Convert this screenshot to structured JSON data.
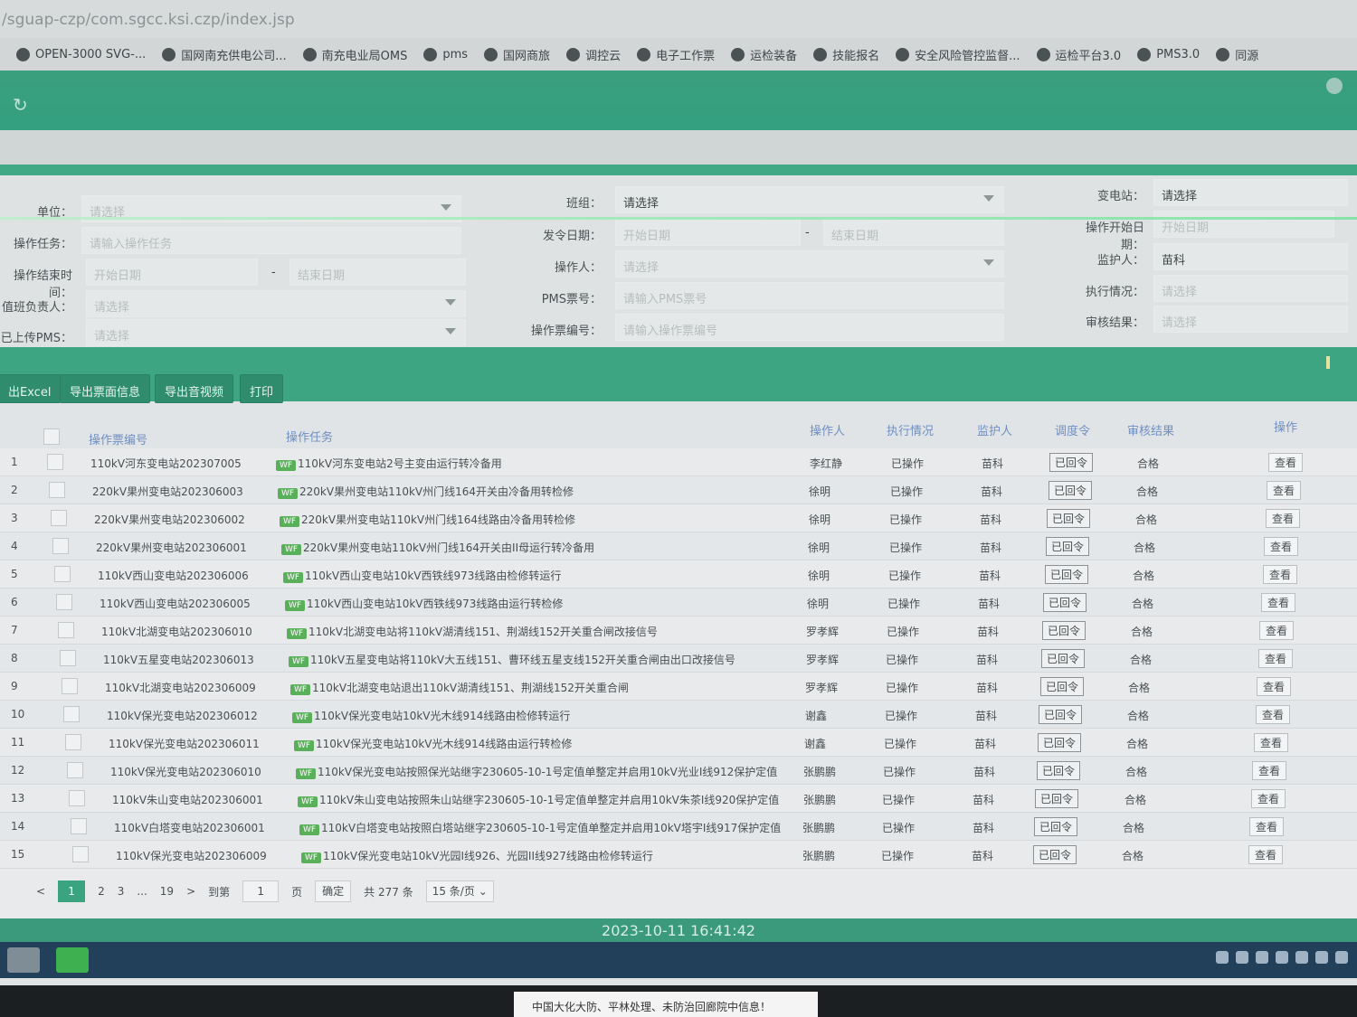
{
  "url": "/sguap-czp/com.sgcc.ksi.czp/index.jsp",
  "bookmarks": [
    "OPEN-3000 SVG-...",
    "国网南充供电公司...",
    "南充电业局OMS",
    "pms",
    "国网商旅",
    "调控云",
    "电子工作票",
    "运检装备",
    "技能报名",
    "安全风险管控监督...",
    "运检平台3.0",
    "PMS3.0",
    "同源"
  ],
  "filters": {
    "unit_label": "单位：",
    "unit_placeholder": "请选择",
    "task_label": "操作任务：",
    "task_placeholder": "请输入操作任务",
    "end_time_label": "操作结束时间：",
    "start_date_placeholder": "开始日期",
    "end_date_placeholder": "结束日期",
    "duty_label": "值班负责人：",
    "duty_placeholder": "请选择",
    "pms_uploaded_label": "已上传PMS：",
    "pms_uploaded_placeholder": "请选择",
    "team_label": "班组：",
    "team_placeholder": "请选择",
    "issue_date_label": "发令日期：",
    "operator_label": "操作人：",
    "operator_placeholder": "请选择",
    "pms_no_label": "PMS票号：",
    "pms_no_placeholder": "请输入PMS票号",
    "ticket_no_label": "操作票编号：",
    "ticket_no_placeholder": "请输入操作票编号",
    "substation_label": "变电站：",
    "substation_placeholder": "请选择",
    "op_start_label": "操作开始日期：",
    "op_start_placeholder": "开始日期",
    "guardian_label": "监护人：",
    "guardian_value": "苗科",
    "exec_label": "执行情况：",
    "exec_placeholder": "请选择",
    "audit_label": "审核结果：",
    "audit_placeholder": "请选择",
    "date_sep": "-"
  },
  "toolbar": {
    "export_excel": "出Excel",
    "export_info": "导出票面信息",
    "export_video": "导出音视频",
    "print": "打印"
  },
  "columns": {
    "ticket_no": "操作票编号",
    "task": "操作任务",
    "operator": "操作人",
    "status": "执行情况",
    "guardian": "监护人",
    "dispatch": "调度令",
    "audit": "审核结果",
    "action": "操作"
  },
  "rows": [
    {
      "idx": "1",
      "no": "110kV河东变电站202307005",
      "task": "110kV河东变电站2号主变由运行转冷备用",
      "op": "李红静",
      "st": "已操作",
      "gd": "苗科",
      "dp": "已回令",
      "au": "合格",
      "ac": "查看"
    },
    {
      "idx": "2",
      "no": "220kV果州变电站202306003",
      "task": "220kV果州变电站110kV州门线164开关由冷备用转检修",
      "op": "徐明",
      "st": "已操作",
      "gd": "苗科",
      "dp": "已回令",
      "au": "合格",
      "ac": "查看"
    },
    {
      "idx": "3",
      "no": "220kV果州变电站202306002",
      "task": "220kV果州变电站110kV州门线164线路由冷备用转检修",
      "op": "徐明",
      "st": "已操作",
      "gd": "苗科",
      "dp": "已回令",
      "au": "合格",
      "ac": "查看"
    },
    {
      "idx": "4",
      "no": "220kV果州变电站202306001",
      "task": "220kV果州变电站110kV州门线164开关由II母运行转冷备用",
      "op": "徐明",
      "st": "已操作",
      "gd": "苗科",
      "dp": "已回令",
      "au": "合格",
      "ac": "查看"
    },
    {
      "idx": "5",
      "no": "110kV西山变电站202306006",
      "task": "110kV西山变电站10kV西铁线973线路由检修转运行",
      "op": "徐明",
      "st": "已操作",
      "gd": "苗科",
      "dp": "已回令",
      "au": "合格",
      "ac": "查看"
    },
    {
      "idx": "6",
      "no": "110kV西山变电站202306005",
      "task": "110kV西山变电站10kV西铁线973线路由运行转检修",
      "op": "徐明",
      "st": "已操作",
      "gd": "苗科",
      "dp": "已回令",
      "au": "合格",
      "ac": "查看"
    },
    {
      "idx": "7",
      "no": "110kV北湖变电站202306010",
      "task": "110kV北湖变电站将110kV湖清线151、荆湖线152开关重合闸改接信号",
      "op": "罗孝辉",
      "st": "已操作",
      "gd": "苗科",
      "dp": "已回令",
      "au": "合格",
      "ac": "查看"
    },
    {
      "idx": "8",
      "no": "110kV五星变电站202306013",
      "task": "110kV五星变电站将110kV大五线151、曹环线五星支线152开关重合闸由出口改接信号",
      "op": "罗孝辉",
      "st": "已操作",
      "gd": "苗科",
      "dp": "已回令",
      "au": "合格",
      "ac": "查看"
    },
    {
      "idx": "9",
      "no": "110kV北湖变电站202306009",
      "task": "110kV北湖变电站退出110kV湖清线151、荆湖线152开关重合闸",
      "op": "罗孝辉",
      "st": "已操作",
      "gd": "苗科",
      "dp": "已回令",
      "au": "合格",
      "ac": "查看"
    },
    {
      "idx": "10",
      "no": "110kV保光变电站202306012",
      "task": "110kV保光变电站10kV光木线914线路由检修转运行",
      "op": "谢鑫",
      "st": "已操作",
      "gd": "苗科",
      "dp": "已回令",
      "au": "合格",
      "ac": "查看"
    },
    {
      "idx": "11",
      "no": "110kV保光变电站202306011",
      "task": "110kV保光变电站10kV光木线914线路由运行转检修",
      "op": "谢鑫",
      "st": "已操作",
      "gd": "苗科",
      "dp": "已回令",
      "au": "合格",
      "ac": "查看"
    },
    {
      "idx": "12",
      "no": "110kV保光变电站202306010",
      "task": "110kV保光变电站按照保光站继字230605-10-1号定值单整定并启用10kV光业I线912保护定值",
      "op": "张鹏鹏",
      "st": "已操作",
      "gd": "苗科",
      "dp": "已回令",
      "au": "合格",
      "ac": "查看"
    },
    {
      "idx": "13",
      "no": "110kV朱山变电站202306001",
      "task": "110kV朱山变电站按照朱山站继字230605-10-1号定值单整定并启用10kV朱茶I线920保护定值",
      "op": "张鹏鹏",
      "st": "已操作",
      "gd": "苗科",
      "dp": "已回令",
      "au": "合格",
      "ac": "查看"
    },
    {
      "idx": "14",
      "no": "110kV白塔变电站202306001",
      "task": "110kV白塔变电站按照白塔站继字230605-10-1号定值单整定并启用10kV塔宇I线917保护定值",
      "op": "张鹏鹏",
      "st": "已操作",
      "gd": "苗科",
      "dp": "已回令",
      "au": "合格",
      "ac": "查看"
    },
    {
      "idx": "15",
      "no": "110kV保光变电站202306009",
      "task": "110kV保光变电站10kV光园I线926、光园II线927线路由检修转运行",
      "op": "张鹏鹏",
      "st": "已操作",
      "gd": "苗科",
      "dp": "已回令",
      "au": "合格",
      "ac": "查看"
    }
  ],
  "wf_badge": "WF",
  "pager": {
    "prev": "<",
    "p1": "1",
    "p2": "2",
    "p3": "3",
    "ellipsis": "...",
    "p19": "19",
    "next": ">",
    "goto": "到第",
    "goto_value": "1",
    "page_unit": "页",
    "confirm": "确定",
    "total": "共 277 条",
    "per_page": "15 条/页"
  },
  "status_time": "2023-10-11 16:41:42",
  "notice": "中国大化大防、平林处理、未防治回廊院中信息！",
  "colors": {
    "primary_green": "#3ea583",
    "header_text": "#6f8fc2",
    "taskbar": "#22405a"
  }
}
